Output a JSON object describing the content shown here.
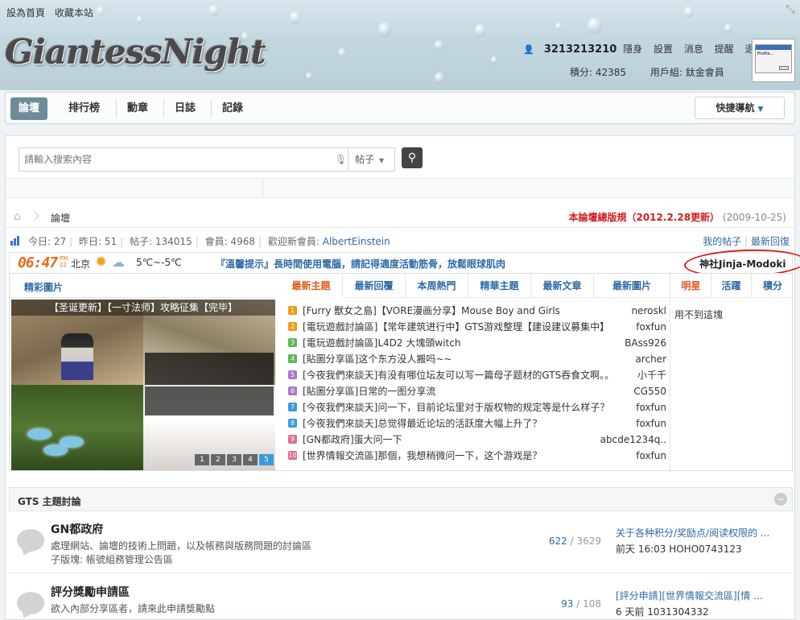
{
  "top_links": [
    "設為首頁",
    "收藏本站"
  ],
  "logo_text": "GiantessNight",
  "user": {
    "name": "3213213210",
    "links": [
      "隱身",
      "設置",
      "消息",
      "提醒",
      "退出"
    ],
    "points_label": "積分: 42385",
    "group_label": "用戶組: 鈦金會員"
  },
  "avatar": {
    "dialog_text": "Profile..."
  },
  "nav": {
    "items": [
      "論壇",
      "排行榜",
      "勳章",
      "日誌",
      "記錄"
    ],
    "active": "論壇",
    "quick_nav": "快捷導航"
  },
  "search": {
    "placeholder": "請輸入搜索內容",
    "type": "帖子"
  },
  "breadcrumb": {
    "current": "論壇"
  },
  "rules": {
    "link": "本論壇總版規（2012.2.28更新）",
    "date": "(2009-10-25)"
  },
  "stats": {
    "today": "今日: 27",
    "yesterday": "昨日: 51",
    "posts": "帖子: 134015",
    "members": "會員: 4968",
    "welcome_label": "歡迎新會員:",
    "new_member": "AlbertEinstein",
    "my_posts": "我的帖子",
    "latest_replies": "最新回復"
  },
  "weather": {
    "time": "06:47",
    "ampm": [
      "PM",
      "22"
    ],
    "city": "北京",
    "temp": "5℃~-5℃",
    "tip": "『溫馨提示』長時間使用電腦，請記得適度活動筋骨，放鬆眼球肌肉",
    "shrine": "神社Jinja-Modoki"
  },
  "slideshow": {
    "title": "精彩圖片",
    "caption": "【圣诞更新】【一寸法师】攻略征集【完毕】",
    "pages": [
      "1",
      "2",
      "3",
      "4",
      "5"
    ],
    "active_page": "5"
  },
  "tabs": [
    "最新主題",
    "最新回覆",
    "本周熱門",
    "精華主題",
    "最新文章",
    "最新圖片"
  ],
  "topics": [
    {
      "num": "1",
      "color": "#f39a1f",
      "title": "[Furry 獸女之島]【VORE漫画分享】Mouse Boy and Girls",
      "author": "neroskl"
    },
    {
      "num": "2",
      "color": "#f39a1f",
      "title": "[電玩遊戲討論區]【常年建筑进行中】GTS游戏整理【建设建议募集中】",
      "author": "foxfun"
    },
    {
      "num": "3",
      "color": "#5fb55a",
      "title": "[電玩遊戲討論區]L4D2 大塊頭witch",
      "author": "BAss926"
    },
    {
      "num": "4",
      "color": "#5fb55a",
      "title": "[貼圖分享區]这个东方没人搬吗~~",
      "author": "archer"
    },
    {
      "num": "5",
      "color": "#a678c9",
      "title": "[今夜我們來談天]有没有哪位坛友可以写一篇母子题材的GTS吞食文啊。。",
      "author": "小千千"
    },
    {
      "num": "6",
      "color": "#a678c9",
      "title": "[貼圖分享區]日常的一图分享流",
      "author": "CG550"
    },
    {
      "num": "7",
      "color": "#3d9ad8",
      "title": "[今夜我們來談天]问一下，目前论坛里对于版权物的规定等是什么样子？",
      "author": "foxfun"
    },
    {
      "num": "8",
      "color": "#3d9ad8",
      "title": "[今夜我們來談天]总觉得最近论坛的活跃度大幅上升了？",
      "author": "foxfun"
    },
    {
      "num": "9",
      "color": "#e07088",
      "title": "[GN都政府]蛋大问一下",
      "author": "abcde1234q.."
    },
    {
      "num": "10",
      "color": "#e07088",
      "title": "[世界情報交流區]那個，我想稍微问一下，这个游戏是？",
      "author": "foxfun"
    }
  ],
  "right_tabs": [
    "明星",
    "活躍",
    "積分"
  ],
  "right_text": "用不到這塊",
  "section": {
    "title": "GTS 主題討論"
  },
  "forums": [
    {
      "name": "GN都政府",
      "desc": "處理網站、論壇的技術上問題，以及帳務與版務問題的討論區",
      "sub": "子版塊: 帳號組務管理公告區",
      "threads": "622",
      "posts": "3629",
      "last_title": "关于各种积分/奖励点/阅读权限的 ...",
      "last_meta": "前天 16:03 HOHO0743123"
    },
    {
      "name": "評分獎勵申請區",
      "desc": "欲入內部分享區者，請來此申請獎勵點",
      "sub": "",
      "threads": "93",
      "posts": "108",
      "last_title": "[評分申請][世界情報交流區][情 ...",
      "last_meta": "6 天前 1031304332"
    }
  ]
}
